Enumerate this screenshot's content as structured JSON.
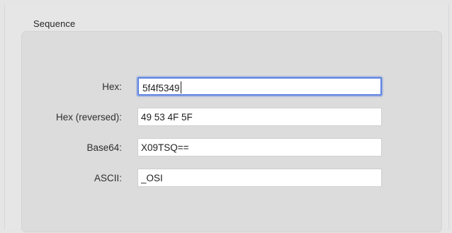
{
  "group": {
    "title": "Sequence"
  },
  "fields": [
    {
      "label": "Hex:",
      "value": "5f4f5349",
      "focused": true
    },
    {
      "label": "Hex (reversed):",
      "value": "49 53 4F 5F",
      "focused": false
    },
    {
      "label": "Base64:",
      "value": "X09TSQ==",
      "focused": false
    },
    {
      "label": "ASCII:",
      "value": "_OSI",
      "focused": false
    }
  ],
  "colors": {
    "focus_ring": "#5b82e0",
    "background": "#e5e5e5",
    "group_box": "#dcdcdc"
  }
}
